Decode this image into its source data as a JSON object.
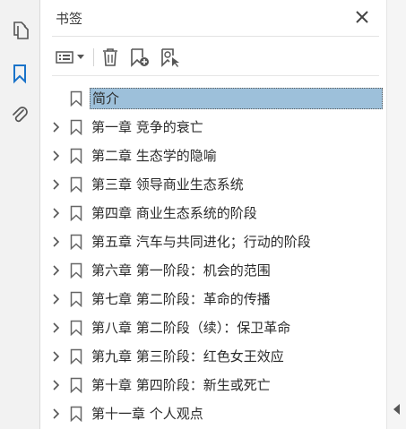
{
  "left_rail": {
    "items": [
      {
        "name": "pages-icon",
        "active": false
      },
      {
        "name": "bookmarks-icon",
        "active": true
      },
      {
        "name": "attachments-icon",
        "active": false
      }
    ]
  },
  "panel": {
    "title": "书签",
    "close_icon": "close-icon"
  },
  "toolbar": {
    "buttons": [
      {
        "name": "options-menu",
        "icon": "list-options-icon"
      },
      {
        "name": "delete-bookmark",
        "icon": "trash-icon"
      },
      {
        "name": "new-bookmark",
        "icon": "new-bookmark-icon"
      },
      {
        "name": "new-bookmark-from-structure",
        "icon": "bookmark-search-icon"
      }
    ]
  },
  "bookmarks": [
    {
      "label": "简介",
      "expandable": false,
      "selected": true
    },
    {
      "label": "第一章  竞争的衰亡",
      "expandable": true,
      "selected": false
    },
    {
      "label": "第二章  生态学的隐喻",
      "expandable": true,
      "selected": false
    },
    {
      "label": "第三章  领导商业生态系统",
      "expandable": true,
      "selected": false
    },
    {
      "label": "第四章  商业生态系统的阶段",
      "expandable": true,
      "selected": false
    },
    {
      "label": "第五章  汽车与共同进化；行动的阶段",
      "expandable": true,
      "selected": false
    },
    {
      "label": "第六章  第一阶段：机会的范围",
      "expandable": true,
      "selected": false
    },
    {
      "label": "第七章  第二阶段：革命的传播",
      "expandable": true,
      "selected": false
    },
    {
      "label": "第八章  第二阶段（续）：保卫革命",
      "expandable": true,
      "selected": false
    },
    {
      "label": "第九章  第三阶段：红色女王效应",
      "expandable": true,
      "selected": false
    },
    {
      "label": "第十章  第四阶段：新生或死亡",
      "expandable": true,
      "selected": false
    },
    {
      "label": "第十一章  个人观点",
      "expandable": true,
      "selected": false
    }
  ],
  "colors": {
    "accent": "#1a73c9",
    "selection": "#9dc0da",
    "icon": "#555555"
  }
}
